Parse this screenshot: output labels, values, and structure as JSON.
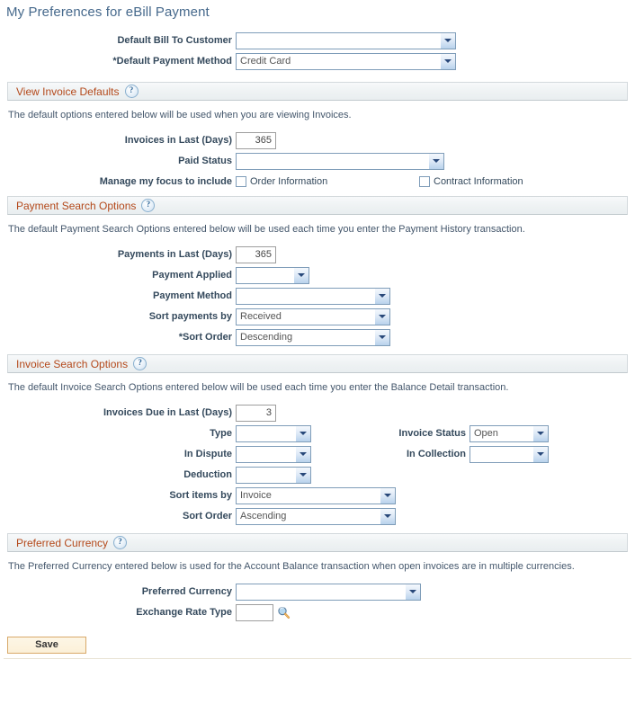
{
  "page": {
    "title": "My Preferences for eBill Payment"
  },
  "icons": {
    "help": "?",
    "lookup": "magnifier-icon",
    "dropdown": "chevron-down-icon"
  },
  "top_fields": [
    {
      "label": "Default Bill To Customer",
      "value": "",
      "type": "select",
      "required": false
    },
    {
      "label": "*Default Payment Method",
      "value": "Credit Card",
      "type": "select",
      "required": true
    }
  ],
  "sections": [
    {
      "key": "view_invoice_defaults",
      "title": "View Invoice Defaults",
      "description": "The default options entered below will be used when you are viewing Invoices.",
      "fields": [
        {
          "label": "Invoices in Last (Days)",
          "value": "365",
          "type": "text"
        },
        {
          "label": "Paid Status",
          "value": "",
          "type": "select"
        }
      ],
      "checkbox_row": {
        "label": "Manage my focus to include",
        "items": [
          {
            "label": "Order Information",
            "checked": false
          },
          {
            "label": "Contract Information",
            "checked": false
          }
        ]
      }
    },
    {
      "key": "payment_search_options",
      "title": "Payment Search Options",
      "description": "The default Payment Search Options entered below will be used each time you enter the Payment History transaction.",
      "fields": [
        {
          "label": "Payments in Last (Days)",
          "value": "365",
          "type": "text"
        },
        {
          "label": "Payment Applied",
          "value": "",
          "type": "select"
        },
        {
          "label": "Payment Method",
          "value": "",
          "type": "select"
        },
        {
          "label": "Sort payments by",
          "value": "Received",
          "type": "select"
        },
        {
          "label": "*Sort Order",
          "value": "Descending",
          "type": "select"
        }
      ]
    },
    {
      "key": "invoice_search_options",
      "title": "Invoice Search Options",
      "description": "The default Invoice Search Options entered below will be used each time you enter the Balance Detail transaction.",
      "fields": [
        {
          "label": "Invoices Due in Last (Days)",
          "value": "3",
          "type": "text"
        },
        {
          "label": "Type",
          "value": "",
          "type": "select"
        },
        {
          "label": "In Dispute",
          "value": "",
          "type": "select"
        },
        {
          "label": "Deduction",
          "value": "",
          "type": "select"
        },
        {
          "label": "Sort items by",
          "value": "Invoice",
          "type": "select"
        },
        {
          "label": "Sort Order",
          "value": "Ascending",
          "type": "select"
        }
      ],
      "right_fields": [
        {
          "label": "Invoice Status",
          "value": "Open",
          "type": "select"
        },
        {
          "label": "In Collection",
          "value": "",
          "type": "select"
        }
      ]
    },
    {
      "key": "preferred_currency",
      "title": "Preferred Currency",
      "description": "The Preferred Currency entered below is used for the Account Balance transaction when open invoices are in multiple currencies.",
      "fields": [
        {
          "label": "Preferred Currency",
          "value": "",
          "type": "select"
        },
        {
          "label": "Exchange Rate Type",
          "value": "",
          "type": "text-lookup"
        }
      ]
    }
  ],
  "footer": {
    "save_label": "Save"
  },
  "colors": {
    "title": "#46698c",
    "section_title": "#b4491b",
    "label": "#34495c",
    "description": "#43566b",
    "select_border": "#7f9db9",
    "save_border": "#d8a96a"
  }
}
